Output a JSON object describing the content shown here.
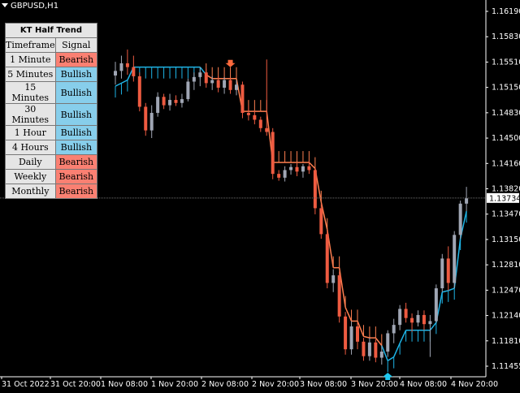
{
  "symbol": "GBPUSD,H1",
  "indicator_panel": {
    "title": "KT Half Trend",
    "col_timeframe": "Timeframe",
    "col_signal": "Signal",
    "rows": [
      {
        "timeframe": "1 Minute",
        "signal": "Bearish"
      },
      {
        "timeframe": "5 Minutes",
        "signal": "Bullish"
      },
      {
        "timeframe": "15 Minutes",
        "signal": "Bullish"
      },
      {
        "timeframe": "30 Minutes",
        "signal": "Bullish"
      },
      {
        "timeframe": "1 Hour",
        "signal": "Bullish"
      },
      {
        "timeframe": "4 Hours",
        "signal": "Bullish"
      },
      {
        "timeframe": "Daily",
        "signal": "Bearish"
      },
      {
        "timeframe": "Weekly",
        "signal": "Bearish"
      },
      {
        "timeframe": "Monthly",
        "signal": "Bearish"
      }
    ]
  },
  "colors": {
    "background": "#000000",
    "bullish": "#87ceeb",
    "bearish": "#fa8072",
    "bull_candle": "#a0a6b4",
    "bear_candle": "#ee5b41",
    "trend_up": "#1eb4e6",
    "trend_down": "#ff7f50",
    "arrow_up": "#1ec8f0",
    "arrow_down": "#ff6a3d",
    "price_line": "#707070"
  },
  "icons": {
    "menu": "dropdown-triangle-icon",
    "sell": "down-arrow-icon",
    "buy": "up-arrow-icon"
  },
  "chart_data": {
    "type": "candlestick",
    "price_axis_labels": [
      "1.16190",
      "1.15830",
      "1.15510",
      "1.15150",
      "1.14830",
      "1.14500",
      "1.14160",
      "1.13820",
      "1.13470",
      "1.13150",
      "1.12810",
      "1.12470",
      "1.12140",
      "1.11810",
      "1.11455"
    ],
    "current_price": "1.13734",
    "time_axis_labels": [
      "31 Oct 2022",
      "31 Oct 20:00",
      "1 Nov 08:00",
      "1 Nov 20:00",
      "2 Nov 08:00",
      "2 Nov 20:00",
      "3 Nov 08:00",
      "3 Nov 20:00",
      "4 Nov 08:00",
      "4 Nov 20:00"
    ],
    "ylim": [
      1.1139,
      1.1633
    ],
    "grid": false,
    "candles": [
      {
        "o": 1.1534,
        "h": 1.1552,
        "l": 1.1522,
        "c": 1.154
      },
      {
        "o": 1.154,
        "h": 1.156,
        "l": 1.153,
        "c": 1.155
      },
      {
        "o": 1.155,
        "h": 1.1568,
        "l": 1.1535,
        "c": 1.1545
      },
      {
        "o": 1.1545,
        "h": 1.156,
        "l": 1.1526,
        "c": 1.1533
      },
      {
        "o": 1.1533,
        "h": 1.1538,
        "l": 1.1487,
        "c": 1.1493
      },
      {
        "o": 1.1493,
        "h": 1.1498,
        "l": 1.1455,
        "c": 1.1462
      },
      {
        "o": 1.1462,
        "h": 1.1495,
        "l": 1.1452,
        "c": 1.1485
      },
      {
        "o": 1.1485,
        "h": 1.1512,
        "l": 1.148,
        "c": 1.1506
      },
      {
        "o": 1.1506,
        "h": 1.151,
        "l": 1.149,
        "c": 1.1495
      },
      {
        "o": 1.1495,
        "h": 1.151,
        "l": 1.1488,
        "c": 1.1502
      },
      {
        "o": 1.1502,
        "h": 1.1508,
        "l": 1.1494,
        "c": 1.1498
      },
      {
        "o": 1.1498,
        "h": 1.151,
        "l": 1.1492,
        "c": 1.1503
      },
      {
        "o": 1.1503,
        "h": 1.153,
        "l": 1.15,
        "c": 1.1526
      },
      {
        "o": 1.1526,
        "h": 1.1538,
        "l": 1.1515,
        "c": 1.1532
      },
      {
        "o": 1.1532,
        "h": 1.1545,
        "l": 1.152,
        "c": 1.1538
      },
      {
        "o": 1.1538,
        "h": 1.1543,
        "l": 1.1518,
        "c": 1.1524
      },
      {
        "o": 1.1524,
        "h": 1.1533,
        "l": 1.1515,
        "c": 1.1528
      },
      {
        "o": 1.1528,
        "h": 1.1534,
        "l": 1.1512,
        "c": 1.1518
      },
      {
        "o": 1.1518,
        "h": 1.1532,
        "l": 1.151,
        "c": 1.1528
      },
      {
        "o": 1.1528,
        "h": 1.1531,
        "l": 1.151,
        "c": 1.1515
      },
      {
        "o": 1.1515,
        "h": 1.1528,
        "l": 1.1508,
        "c": 1.1522
      },
      {
        "o": 1.1522,
        "h": 1.1526,
        "l": 1.1478,
        "c": 1.1485
      },
      {
        "o": 1.1485,
        "h": 1.1495,
        "l": 1.1475,
        "c": 1.1482
      },
      {
        "o": 1.1482,
        "h": 1.1488,
        "l": 1.147,
        "c": 1.1476
      },
      {
        "o": 1.1476,
        "h": 1.148,
        "l": 1.146,
        "c": 1.1465
      },
      {
        "o": 1.1465,
        "h": 1.1555,
        "l": 1.1455,
        "c": 1.146
      },
      {
        "o": 1.146,
        "h": 1.1465,
        "l": 1.1398,
        "c": 1.1405
      },
      {
        "o": 1.1405,
        "h": 1.141,
        "l": 1.1396,
        "c": 1.14
      },
      {
        "o": 1.14,
        "h": 1.1415,
        "l": 1.1395,
        "c": 1.141
      },
      {
        "o": 1.141,
        "h": 1.1418,
        "l": 1.1404,
        "c": 1.1414
      },
      {
        "o": 1.1414,
        "h": 1.1419,
        "l": 1.1402,
        "c": 1.1408
      },
      {
        "o": 1.1408,
        "h": 1.1418,
        "l": 1.14,
        "c": 1.1415
      },
      {
        "o": 1.1415,
        "h": 1.1422,
        "l": 1.1405,
        "c": 1.141
      },
      {
        "o": 1.141,
        "h": 1.1413,
        "l": 1.1352,
        "c": 1.136
      },
      {
        "o": 1.136,
        "h": 1.1366,
        "l": 1.132,
        "c": 1.1326
      },
      {
        "o": 1.1326,
        "h": 1.133,
        "l": 1.1255,
        "c": 1.1262
      },
      {
        "o": 1.1262,
        "h": 1.128,
        "l": 1.125,
        "c": 1.1272
      },
      {
        "o": 1.1272,
        "h": 1.1277,
        "l": 1.121,
        "c": 1.1218
      },
      {
        "o": 1.1218,
        "h": 1.1224,
        "l": 1.1168,
        "c": 1.1175
      },
      {
        "o": 1.1175,
        "h": 1.1212,
        "l": 1.1168,
        "c": 1.1205
      },
      {
        "o": 1.1205,
        "h": 1.121,
        "l": 1.1175,
        "c": 1.1185
      },
      {
        "o": 1.1185,
        "h": 1.119,
        "l": 1.116,
        "c": 1.1166
      },
      {
        "o": 1.1166,
        "h": 1.119,
        "l": 1.116,
        "c": 1.1184
      },
      {
        "o": 1.1184,
        "h": 1.1188,
        "l": 1.1158,
        "c": 1.1164
      },
      {
        "o": 1.1164,
        "h": 1.118,
        "l": 1.1155,
        "c": 1.1172
      },
      {
        "o": 1.1172,
        "h": 1.12,
        "l": 1.1165,
        "c": 1.1196
      },
      {
        "o": 1.1196,
        "h": 1.1215,
        "l": 1.1183,
        "c": 1.1207
      },
      {
        "o": 1.1207,
        "h": 1.1233,
        "l": 1.12,
        "c": 1.1228
      },
      {
        "o": 1.1228,
        "h": 1.1236,
        "l": 1.121,
        "c": 1.1216
      },
      {
        "o": 1.1216,
        "h": 1.1222,
        "l": 1.1198,
        "c": 1.121
      },
      {
        "o": 1.121,
        "h": 1.1226,
        "l": 1.1205,
        "c": 1.122
      },
      {
        "o": 1.122,
        "h": 1.1226,
        "l": 1.12,
        "c": 1.1208
      },
      {
        "o": 1.1208,
        "h": 1.122,
        "l": 1.1165,
        "c": 1.1212
      },
      {
        "o": 1.1212,
        "h": 1.126,
        "l": 1.121,
        "c": 1.1255
      },
      {
        "o": 1.1255,
        "h": 1.13,
        "l": 1.125,
        "c": 1.1294
      },
      {
        "o": 1.1294,
        "h": 1.131,
        "l": 1.1252,
        "c": 1.1262
      },
      {
        "o": 1.1262,
        "h": 1.133,
        "l": 1.1255,
        "c": 1.1325
      },
      {
        "o": 1.1325,
        "h": 1.137,
        "l": 1.132,
        "c": 1.1366
      },
      {
        "o": 1.1366,
        "h": 1.1388,
        "l": 1.1356,
        "c": 1.1373
      }
    ],
    "trend_line": [
      {
        "v": 1.152,
        "dir": "up"
      },
      {
        "v": 1.1524,
        "dir": "up"
      },
      {
        "v": 1.1528,
        "dir": "up"
      },
      {
        "v": 1.1545,
        "dir": "up"
      },
      {
        "v": 1.1545,
        "dir": "up"
      },
      {
        "v": 1.1545,
        "dir": "up"
      },
      {
        "v": 1.1545,
        "dir": "up"
      },
      {
        "v": 1.1545,
        "dir": "up"
      },
      {
        "v": 1.1545,
        "dir": "up"
      },
      {
        "v": 1.1545,
        "dir": "up"
      },
      {
        "v": 1.1545,
        "dir": "up"
      },
      {
        "v": 1.1545,
        "dir": "up"
      },
      {
        "v": 1.1545,
        "dir": "up"
      },
      {
        "v": 1.1545,
        "dir": "up"
      },
      {
        "v": 1.1545,
        "dir": "up"
      },
      {
        "v": 1.1535,
        "dir": "down"
      },
      {
        "v": 1.153,
        "dir": "down"
      },
      {
        "v": 1.153,
        "dir": "down"
      },
      {
        "v": 1.153,
        "dir": "down"
      },
      {
        "v": 1.153,
        "dir": "down"
      },
      {
        "v": 1.153,
        "dir": "down"
      },
      {
        "v": 1.1487,
        "dir": "down"
      },
      {
        "v": 1.1487,
        "dir": "down"
      },
      {
        "v": 1.1487,
        "dir": "down"
      },
      {
        "v": 1.1487,
        "dir": "down"
      },
      {
        "v": 1.1487,
        "dir": "down"
      },
      {
        "v": 1.142,
        "dir": "down"
      },
      {
        "v": 1.142,
        "dir": "down"
      },
      {
        "v": 1.142,
        "dir": "down"
      },
      {
        "v": 1.142,
        "dir": "down"
      },
      {
        "v": 1.142,
        "dir": "down"
      },
      {
        "v": 1.142,
        "dir": "down"
      },
      {
        "v": 1.142,
        "dir": "down"
      },
      {
        "v": 1.1412,
        "dir": "down"
      },
      {
        "v": 1.1368,
        "dir": "down"
      },
      {
        "v": 1.1332,
        "dir": "down"
      },
      {
        "v": 1.1282,
        "dir": "down"
      },
      {
        "v": 1.1282,
        "dir": "down"
      },
      {
        "v": 1.123,
        "dir": "down"
      },
      {
        "v": 1.1212,
        "dir": "down"
      },
      {
        "v": 1.1212,
        "dir": "down"
      },
      {
        "v": 1.1192,
        "dir": "down"
      },
      {
        "v": 1.119,
        "dir": "down"
      },
      {
        "v": 1.119,
        "dir": "down"
      },
      {
        "v": 1.118,
        "dir": "down"
      },
      {
        "v": 1.116,
        "dir": "up"
      },
      {
        "v": 1.1165,
        "dir": "up"
      },
      {
        "v": 1.1183,
        "dir": "up"
      },
      {
        "v": 1.12,
        "dir": "up"
      },
      {
        "v": 1.12,
        "dir": "up"
      },
      {
        "v": 1.12,
        "dir": "up"
      },
      {
        "v": 1.12,
        "dir": "up"
      },
      {
        "v": 1.12,
        "dir": "up"
      },
      {
        "v": 1.121,
        "dir": "up"
      },
      {
        "v": 1.125,
        "dir": "up"
      },
      {
        "v": 1.1252,
        "dir": "up"
      },
      {
        "v": 1.1255,
        "dir": "up"
      },
      {
        "v": 1.132,
        "dir": "up"
      },
      {
        "v": 1.1356,
        "dir": "up"
      }
    ],
    "signals": [
      {
        "type": "sell",
        "candle": 19
      },
      {
        "type": "buy",
        "candle": 45
      }
    ]
  }
}
